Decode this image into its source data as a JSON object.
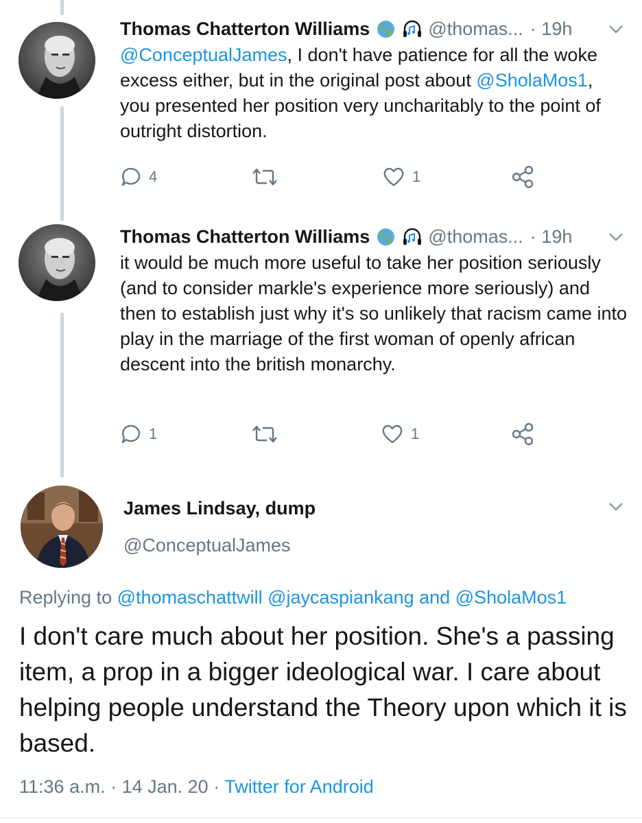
{
  "tweets": [
    {
      "author_name": "Thomas Chatterton Williams",
      "author_icons": [
        "globe-emoji",
        "headphones-music-emoji"
      ],
      "handle": "@thomas...",
      "separator": "·",
      "time": "19h",
      "segments": [
        {
          "text": "@ConceptualJames",
          "type": "mention"
        },
        {
          "text": ", I don't have patience for all the woke excess either, but in the original post about ",
          "type": "text"
        },
        {
          "text": "@SholaMos1",
          "type": "mention"
        },
        {
          "text": ", you presented her position very uncharitably to the point of outright distortion.",
          "type": "text"
        }
      ],
      "reply_count": "4",
      "retweet_count": "",
      "like_count": "1"
    },
    {
      "author_name": "Thomas Chatterton Williams",
      "author_icons": [
        "globe-emoji",
        "headphones-music-emoji"
      ],
      "handle": "@thomas...",
      "separator": "·",
      "time": "19h",
      "segments": [
        {
          "text": "it would be much more useful to take her position seriously (and to consider markle's experience more seriously) and then to establish just why it's so unlikely that racism came into play in the marriage of the first woman of openly african descent into the british monarchy.",
          "type": "text"
        }
      ],
      "reply_count": "1",
      "retweet_count": "",
      "like_count": "1"
    }
  ],
  "main_tweet": {
    "author_name": "James Lindsay, dump",
    "handle": "@ConceptualJames",
    "replying_prefix": "Replying to ",
    "replying_mentions": [
      "@thomaschattwill",
      "@jaycaspiankang"
    ],
    "replying_and": " and ",
    "replying_last": "@SholaMos1",
    "text": "I don't care much about her position. She's a passing item, a prop in a bigger ideological war. I care about helping people understand the Theory upon which it is based.",
    "time": "11:36 a.m.",
    "date": "14 Jan. 20",
    "separator": " · ",
    "source": "Twitter for Android"
  },
  "colors": {
    "link": "#1b95e0",
    "secondary": "#657786",
    "thread_line": "#ccd6dd",
    "text": "#14171a"
  }
}
